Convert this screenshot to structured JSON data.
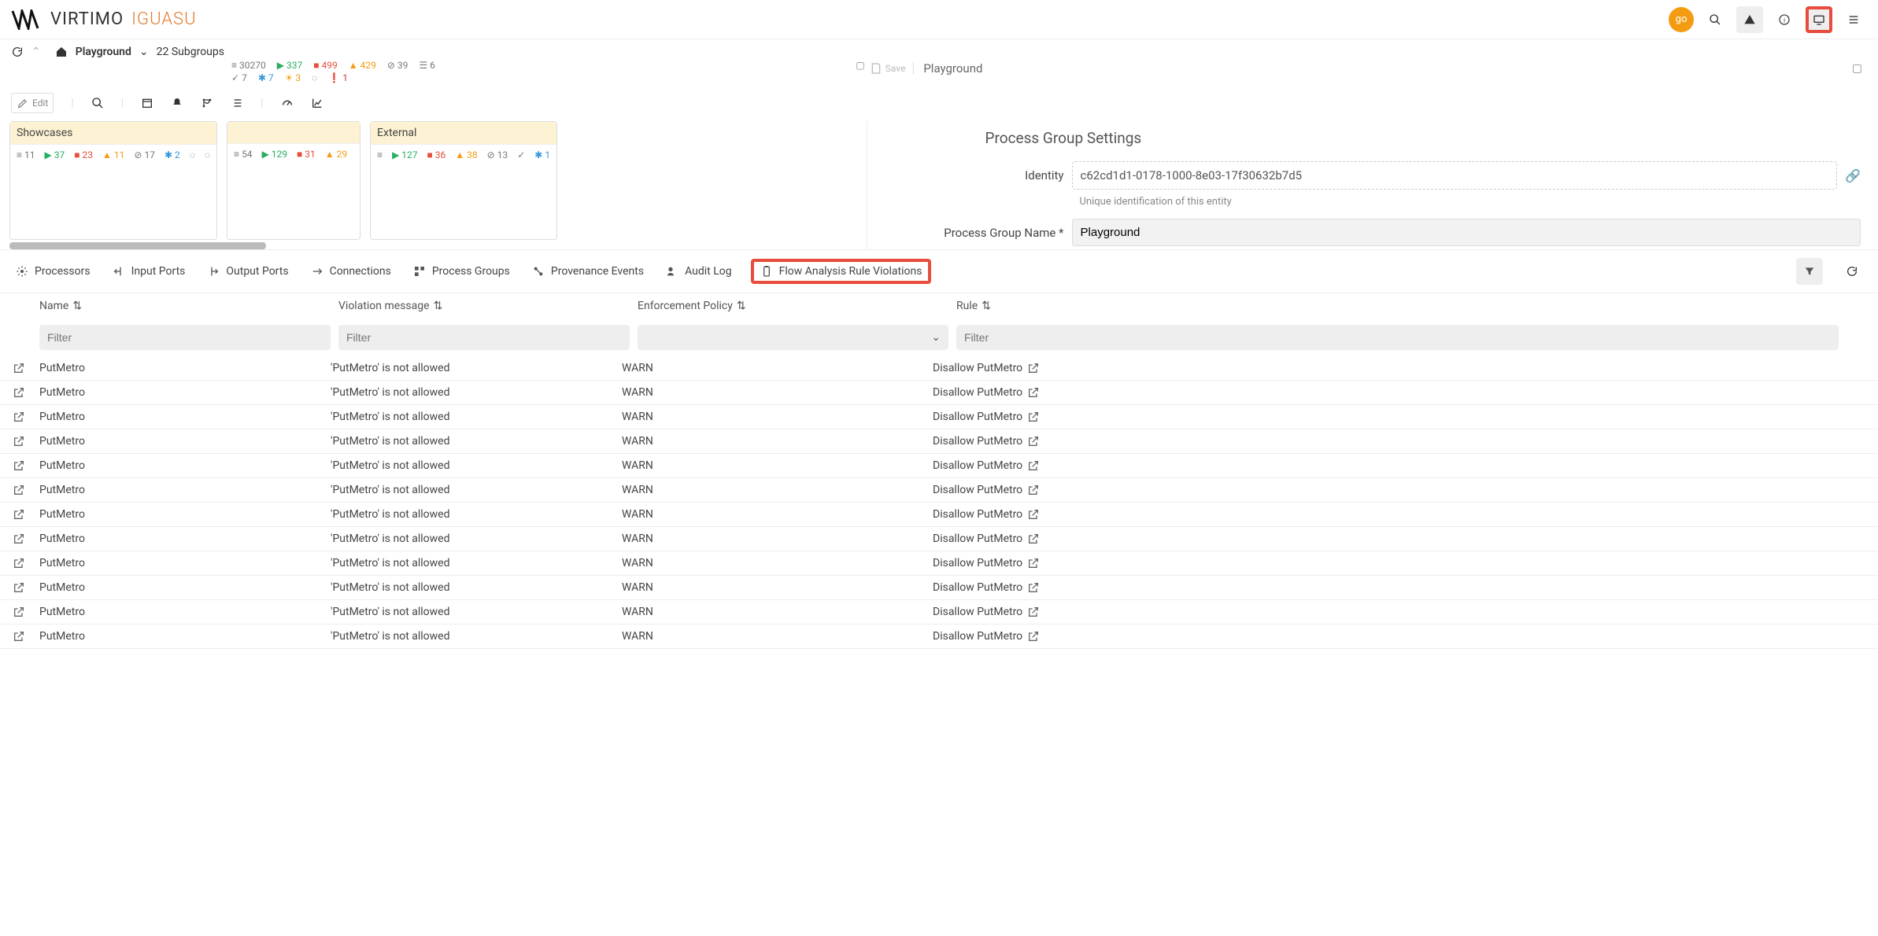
{
  "topbar": {
    "brand_main": "VIRTIMO",
    "brand_sub": "IGUASU",
    "avatar": "go"
  },
  "breadcrumb": {
    "home_label": "Playground",
    "sub_label": "22 Subgroups"
  },
  "global_stats": {
    "queued": "30270",
    "running": "337",
    "stopped": "499",
    "invalid": "429",
    "disabled": "39",
    "sorted": "6",
    "check": "7",
    "star": "7",
    "sun": "3",
    "err": "1"
  },
  "edit_btn": "Edit",
  "right_panel": {
    "save_label": "Save",
    "title": "Playground",
    "section_title": "Process Group Settings",
    "identity_label": "Identity",
    "identity_value": "c62cd1d1-0178-1000-8e03-17f30632b7d5",
    "identity_helper": "Unique identification of this entity",
    "pgname_label": "Process Group Name *",
    "pgname_value": "Playground"
  },
  "groups": [
    {
      "title": "Showcases",
      "stats": {
        "queued": "11",
        "running": "37",
        "stopped": "23",
        "invalid": "11",
        "disabled": "17",
        "star": "2"
      }
    },
    {
      "title": "",
      "stats": {
        "queued": "54",
        "running": "129",
        "stopped": "31",
        "invalid": "29"
      }
    },
    {
      "title": "External",
      "stats": {
        "running": "127",
        "stopped": "36",
        "invalid": "38",
        "disabled": "13",
        "star": "1"
      }
    }
  ],
  "tabs": {
    "processors": "Processors",
    "input_ports": "Input Ports",
    "output_ports": "Output Ports",
    "connections": "Connections",
    "process_groups": "Process Groups",
    "provenance": "Provenance Events",
    "audit_log": "Audit Log",
    "violations": "Flow Analysis Rule Violations"
  },
  "columns": {
    "name": "Name",
    "violation": "Violation message",
    "policy": "Enforcement Policy",
    "rule": "Rule"
  },
  "filters": {
    "placeholder": "Filter"
  },
  "rows": [
    {
      "name": "PutMetro",
      "msg": "'PutMetro' is not allowed",
      "policy": "WARN",
      "rule": "Disallow PutMetro"
    },
    {
      "name": "PutMetro",
      "msg": "'PutMetro' is not allowed",
      "policy": "WARN",
      "rule": "Disallow PutMetro"
    },
    {
      "name": "PutMetro",
      "msg": "'PutMetro' is not allowed",
      "policy": "WARN",
      "rule": "Disallow PutMetro"
    },
    {
      "name": "PutMetro",
      "msg": "'PutMetro' is not allowed",
      "policy": "WARN",
      "rule": "Disallow PutMetro"
    },
    {
      "name": "PutMetro",
      "msg": "'PutMetro' is not allowed",
      "policy": "WARN",
      "rule": "Disallow PutMetro"
    },
    {
      "name": "PutMetro",
      "msg": "'PutMetro' is not allowed",
      "policy": "WARN",
      "rule": "Disallow PutMetro"
    },
    {
      "name": "PutMetro",
      "msg": "'PutMetro' is not allowed",
      "policy": "WARN",
      "rule": "Disallow PutMetro"
    },
    {
      "name": "PutMetro",
      "msg": "'PutMetro' is not allowed",
      "policy": "WARN",
      "rule": "Disallow PutMetro"
    },
    {
      "name": "PutMetro",
      "msg": "'PutMetro' is not allowed",
      "policy": "WARN",
      "rule": "Disallow PutMetro"
    },
    {
      "name": "PutMetro",
      "msg": "'PutMetro' is not allowed",
      "policy": "WARN",
      "rule": "Disallow PutMetro"
    },
    {
      "name": "PutMetro",
      "msg": "'PutMetro' is not allowed",
      "policy": "WARN",
      "rule": "Disallow PutMetro"
    },
    {
      "name": "PutMetro",
      "msg": "'PutMetro' is not allowed",
      "policy": "WARN",
      "rule": "Disallow PutMetro"
    }
  ]
}
